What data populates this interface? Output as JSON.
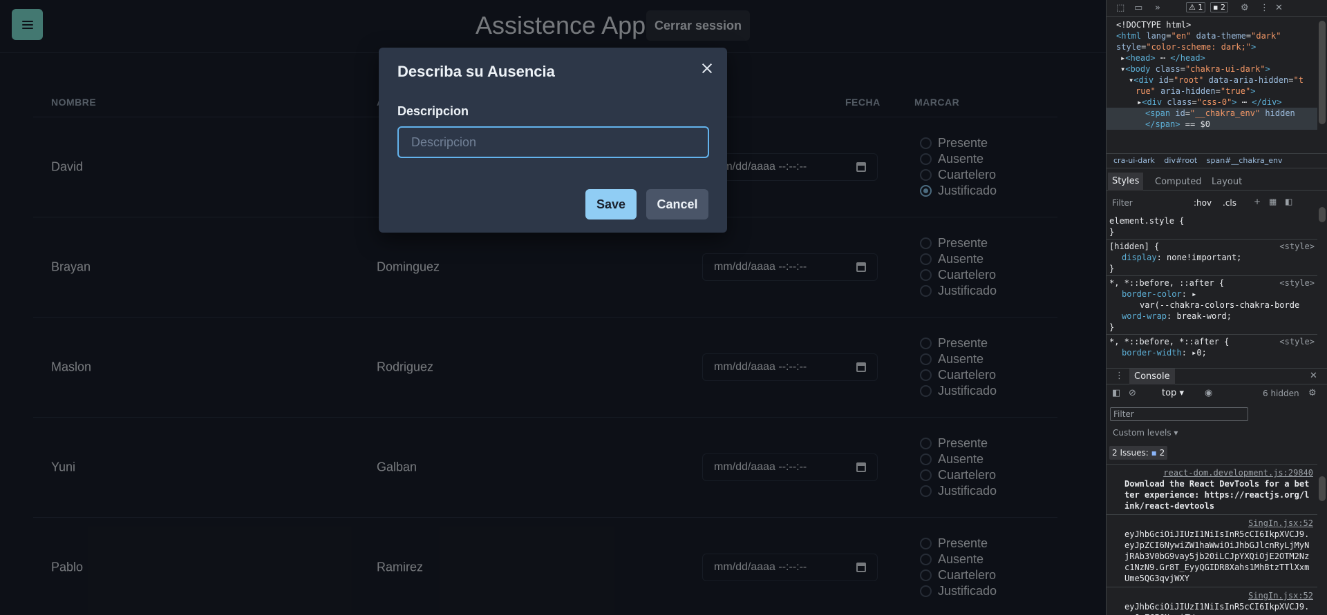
{
  "app": {
    "title": "Assistence App",
    "logout_label": "Cerrar session",
    "menu_icon": "hamburger-menu-icon",
    "accent_color": "#81e6d9"
  },
  "table": {
    "headers": {
      "nombre": "NOMBRE",
      "apellido": "A",
      "fecha": "FECHA",
      "marcar": "MARCAR"
    },
    "date_placeholder": "mm/dd/aaaa  --:--:--",
    "rows": [
      {
        "nombre": "David",
        "apellido": "",
        "options": [
          "Presente",
          "Ausente",
          "Cuartelero",
          "Justificado"
        ],
        "selected": "Justificado"
      },
      {
        "nombre": "Brayan",
        "apellido": "Dominguez",
        "options": [
          "Presente",
          "Ausente",
          "Cuartelero",
          "Justificado"
        ],
        "selected": ""
      },
      {
        "nombre": "Maslon",
        "apellido": "Rodriguez",
        "options": [
          "Presente",
          "Ausente",
          "Cuartelero",
          "Justificado"
        ],
        "selected": ""
      },
      {
        "nombre": "Yuni",
        "apellido": "Galban",
        "options": [
          "Presente",
          "Ausente",
          "Cuartelero",
          "Justificado"
        ],
        "selected": ""
      },
      {
        "nombre": "Pablo",
        "apellido": "Ramirez",
        "options": [
          "Presente",
          "Ausente",
          "Cuartelero",
          "Justificado"
        ],
        "selected": ""
      }
    ]
  },
  "modal": {
    "title": "Describa su Ausencia",
    "field_label": "Descripcion",
    "field_placeholder": "Descripcion",
    "field_value": "",
    "save_label": "Save",
    "cancel_label": "Cancel",
    "save_color": "#90cdf4"
  },
  "devtools": {
    "warnings": "1",
    "messages": "2",
    "dom": {
      "l1": "<!DOCTYPE html>",
      "l2a": "<html ",
      "l2b": "lang",
      "l2c": "\"en\"",
      "l2d": " data-theme",
      "l2e": "\"dark\"",
      "l3a": "style",
      "l3b": "\"color-scheme: dark;\"",
      "l4": "<head>",
      "l4b": "</head>",
      "l5a": "<body ",
      "l5b": "class",
      "l5c": "\"chakra-ui-dark\"",
      "l6a": "<div ",
      "l6b": "id",
      "l6c": "\"root\"",
      "l6d": " data-aria-hidden",
      "l6e": "\"t",
      "l7a": "rue\"",
      "l7b": " aria-hidden",
      "l7c": "\"true\"",
      "l8a": "<div ",
      "l8b": "class",
      "l8c": "\"css-0\"",
      "l8d": "</div>",
      "l9a": "<span ",
      "l9b": "id",
      "l9c": "\"__chakra_env\"",
      "l9d": " hidden",
      "l10a": "</span>",
      "l10b": " == $0"
    },
    "breadcrumbs": [
      "cra-ui-dark",
      "div#root",
      "span#__chakra_env"
    ],
    "tabs": [
      "Styles",
      "Computed",
      "Layout"
    ],
    "filter_placeholder": "Filter",
    "hov": ":hov",
    "cls": ".cls",
    "styles": {
      "r1_sel": "element.style {",
      "r2_sel": "[hidden] {",
      "r2_src": "<style>",
      "r2_prop": "display",
      "r2_val": "none!important;",
      "r3_sel": "*, *::before, ::after {",
      "r3_src": "<style>",
      "r3_prop1": "border-color",
      "r3_val1": "var(--chakra-colors-chakra-borde",
      "r3_prop2": "word-wrap",
      "r3_val2": "break-word;",
      "r4_sel": "*, *::before, *::after {",
      "r4_src": "<style>",
      "r4_prop": "border-width",
      "r4_val": "0;"
    },
    "console": {
      "tab": "Console",
      "context": "top",
      "hidden": "6 hidden",
      "filter": "Filter",
      "levels": "Custom levels",
      "issues_label": "2 Issues:",
      "issues_count": "2",
      "log1_src": "react-dom.development.js:29840",
      "log1_msg": "Download the React DevTools for a better experience: https://reactjs.org/link/react-devtools",
      "log2_src": "SingIn.jsx:52",
      "log2_msg": "eyJhbGciOiJIUzI1NiIsInR5cCI6IkpXVCJ9.eyJpZCI6NywiZW1haWwiOiJhbGJlcnRyLjMyNjRAb3V0bG9vay5jb20iLCJpYXQiOjE2OTM2Nzc1NzN9.Gr8T_EyyQGIDR8Xahs1MhBtzTTlXxmUme5QG3qvjWXY",
      "log3_src": "SingIn.jsx:52",
      "log3_msg": "eyJhbGciOiJIUzI1NiIsInR5cCI6IkpXVCJ9.eyJpZCI6NywiZW"
    }
  }
}
